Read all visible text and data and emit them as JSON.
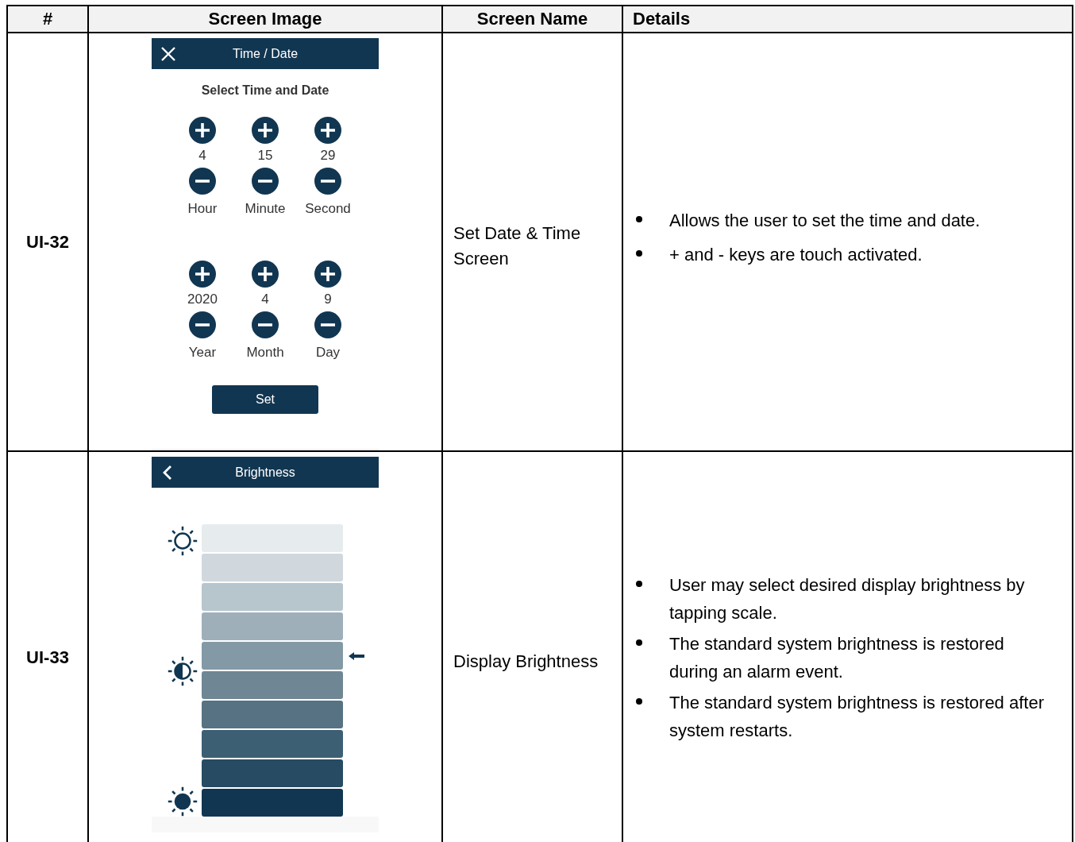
{
  "table": {
    "columns": [
      "#",
      "Screen Image",
      "Screen Name",
      "Details"
    ],
    "rows": [
      {
        "id": "UI-32",
        "kind": "time_date",
        "screen": {
          "title": "Time / Date",
          "heading": "Select Time and Date",
          "groups": [
            [
              {
                "value": "4",
                "label": "Hour"
              },
              {
                "value": "15",
                "label": "Minute"
              },
              {
                "value": "29",
                "label": "Second"
              }
            ],
            [
              {
                "value": "2020",
                "label": "Year"
              },
              {
                "value": "4",
                "label": "Month"
              },
              {
                "value": "9",
                "label": "Day"
              }
            ]
          ],
          "button": "Set"
        },
        "name": "Set Date & Time Screen",
        "details": [
          "Allows the user to set the time and date.",
          "+ and - keys are touch activated."
        ]
      },
      {
        "id": "UI-33",
        "kind": "brightness",
        "screen": {
          "title": "Brightness",
          "segments": [
            {
              "selected": false
            },
            {
              "selected": false
            },
            {
              "selected": false
            },
            {
              "selected": false
            },
            {
              "selected": true
            },
            {
              "selected": false
            },
            {
              "selected": false
            },
            {
              "selected": false
            },
            {
              "selected": false
            },
            {
              "selected": false
            }
          ]
        },
        "name": "Display Brightness",
        "details": [
          "User may select desired display brightness by tapping scale.",
          "The standard system brightness is restored during an alarm event.",
          "The standard system brightness is restored after system restarts."
        ]
      }
    ]
  }
}
